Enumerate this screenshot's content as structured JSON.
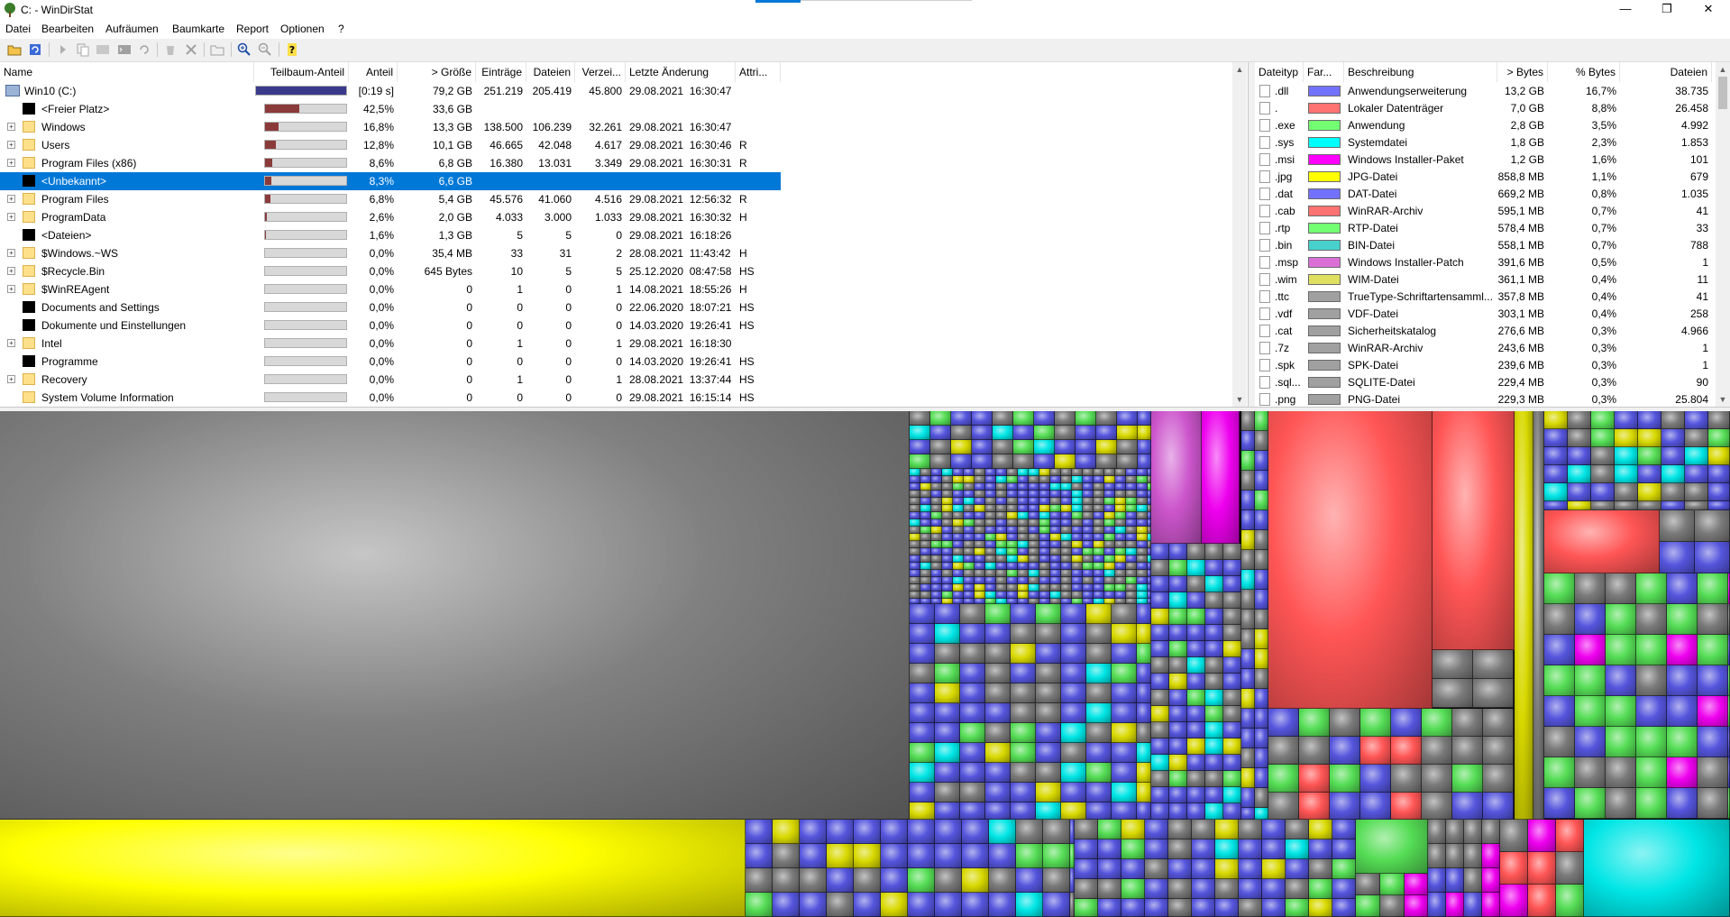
{
  "window": {
    "title": "C: - WinDirStat"
  },
  "menu": [
    "Datei",
    "Bearbeiten",
    "Aufräumen",
    "Baumkarte",
    "Report",
    "Optionen",
    "?"
  ],
  "tree": {
    "columns": [
      "Name",
      "Teilbaum-Anteil",
      "Anteil",
      "> Größe",
      "Einträge",
      "Dateien",
      "Verzei...",
      "Letzte Änderung",
      "Attri..."
    ],
    "rows": [
      {
        "name": "Win10 (C:)",
        "icon": "drive-icon",
        "share_text": "[0:19 s]",
        "fill": 1.0,
        "size": "79,2 GB",
        "entries": "251.219",
        "files": "205.419",
        "dirs": "45.800",
        "modified": "29.08.2021  16:30:47",
        "attr": ""
      },
      {
        "name": "<Freier Platz>",
        "icon": "free-space-icon",
        "share_text": "42,5%",
        "fill": 0.425,
        "size": "33,6 GB",
        "entries": "",
        "files": "",
        "dirs": "",
        "modified": "",
        "attr": ""
      },
      {
        "name": "Windows",
        "icon": "folder-icon",
        "share_text": "16,8%",
        "fill": 0.168,
        "size": "13,3 GB",
        "entries": "138.500",
        "files": "106.239",
        "dirs": "32.261",
        "modified": "29.08.2021  16:30:47",
        "attr": ""
      },
      {
        "name": "Users",
        "icon": "folder-icon",
        "share_text": "12,8%",
        "fill": 0.128,
        "size": "10,1 GB",
        "entries": "46.665",
        "files": "42.048",
        "dirs": "4.617",
        "modified": "29.08.2021  16:30:46",
        "attr": "R"
      },
      {
        "name": "Program Files (x86)",
        "icon": "folder-icon",
        "share_text": "8,6%",
        "fill": 0.086,
        "size": "6,8 GB",
        "entries": "16.380",
        "files": "13.031",
        "dirs": "3.349",
        "modified": "29.08.2021  16:30:31",
        "attr": "R"
      },
      {
        "name": "<Unbekannt>",
        "icon": "unknown-icon",
        "share_text": "8,3%",
        "fill": 0.083,
        "size": "6,6 GB",
        "entries": "",
        "files": "",
        "dirs": "",
        "modified": "",
        "attr": ""
      },
      {
        "name": "Program Files",
        "icon": "folder-icon",
        "share_text": "6,8%",
        "fill": 0.068,
        "size": "5,4 GB",
        "entries": "45.576",
        "files": "41.060",
        "dirs": "4.516",
        "modified": "29.08.2021  12:56:32",
        "attr": "R"
      },
      {
        "name": "ProgramData",
        "icon": "folder-icon",
        "share_text": "2,6%",
        "fill": 0.026,
        "size": "2,0 GB",
        "entries": "4.033",
        "files": "3.000",
        "dirs": "1.033",
        "modified": "29.08.2021  16:30:32",
        "attr": "H"
      },
      {
        "name": "<Dateien>",
        "icon": "files-icon",
        "share_text": "1,6%",
        "fill": 0.016,
        "size": "1,3 GB",
        "entries": "5",
        "files": "5",
        "dirs": "0",
        "modified": "29.08.2021  16:18:26",
        "attr": ""
      },
      {
        "name": "$Windows.~WS",
        "icon": "folder-icon",
        "share_text": "0,0%",
        "fill": 0.0,
        "size": "35,4 MB",
        "entries": "33",
        "files": "31",
        "dirs": "2",
        "modified": "28.08.2021  11:43:42",
        "attr": "H"
      },
      {
        "name": "$Recycle.Bin",
        "icon": "folder-icon",
        "share_text": "0,0%",
        "fill": 0.0,
        "size": "645 Bytes",
        "entries": "10",
        "files": "5",
        "dirs": "5",
        "modified": "25.12.2020  08:47:58",
        "attr": "HS"
      },
      {
        "name": "$WinREAgent",
        "icon": "folder-icon",
        "share_text": "0,0%",
        "fill": 0.0,
        "size": "0",
        "entries": "1",
        "files": "0",
        "dirs": "1",
        "modified": "14.08.2021  18:55:26",
        "attr": "H"
      },
      {
        "name": "Documents and Settings",
        "icon": "junction-icon",
        "share_text": "0,0%",
        "fill": 0.0,
        "size": "0",
        "entries": "0",
        "files": "0",
        "dirs": "0",
        "modified": "22.06.2020  18:07:21",
        "attr": "HS"
      },
      {
        "name": "Dokumente und Einstellungen",
        "icon": "junction-icon",
        "share_text": "0,0%",
        "fill": 0.0,
        "size": "0",
        "entries": "0",
        "files": "0",
        "dirs": "0",
        "modified": "14.03.2020  19:26:41",
        "attr": "HS"
      },
      {
        "name": "Intel",
        "icon": "folder-icon",
        "share_text": "0,0%",
        "fill": 0.0,
        "size": "0",
        "entries": "1",
        "files": "0",
        "dirs": "1",
        "modified": "29.08.2021  16:18:30",
        "attr": ""
      },
      {
        "name": "Programme",
        "icon": "junction-icon",
        "share_text": "0,0%",
        "fill": 0.0,
        "size": "0",
        "entries": "0",
        "files": "0",
        "dirs": "0",
        "modified": "14.03.2020  19:26:41",
        "attr": "HS"
      },
      {
        "name": "Recovery",
        "icon": "folder-icon",
        "share_text": "0,0%",
        "fill": 0.0,
        "size": "0",
        "entries": "1",
        "files": "0",
        "dirs": "1",
        "modified": "28.08.2021  13:37:44",
        "attr": "HS"
      },
      {
        "name": "System Volume Information",
        "icon": "folder-icon",
        "share_text": "0,0%",
        "fill": 0.0,
        "size": "0",
        "entries": "0",
        "files": "0",
        "dirs": "0",
        "modified": "29.08.2021  16:15:14",
        "attr": "HS"
      }
    ],
    "selected_row": 5
  },
  "extensions": {
    "columns": [
      "Dateityp",
      "Far...",
      "Beschreibung",
      "> Bytes",
      "% Bytes",
      "Dateien"
    ],
    "rows": [
      {
        "ext": ".dll",
        "color": "#7272ff",
        "desc": "Anwendungserweiterung",
        "bytes": "13,2 GB",
        "pct": "16,7%",
        "files": "38.735"
      },
      {
        "ext": ".",
        "color": "#ff7272",
        "desc": "Lokaler Datenträger",
        "bytes": "7,0 GB",
        "pct": "8,8%",
        "files": "26.458"
      },
      {
        "ext": ".exe",
        "color": "#72ff72",
        "desc": "Anwendung",
        "bytes": "2,8 GB",
        "pct": "3,5%",
        "files": "4.992"
      },
      {
        "ext": ".sys",
        "color": "#00ffff",
        "desc": "Systemdatei",
        "bytes": "1,8 GB",
        "pct": "2,3%",
        "files": "1.853"
      },
      {
        "ext": ".msi",
        "color": "#ff00ff",
        "desc": "Windows Installer-Paket",
        "bytes": "1,2 GB",
        "pct": "1,6%",
        "files": "101"
      },
      {
        "ext": ".jpg",
        "color": "#ffff00",
        "desc": "JPG-Datei",
        "bytes": "858,8 MB",
        "pct": "1,1%",
        "files": "679"
      },
      {
        "ext": ".dat",
        "color": "#7272ff",
        "desc": "DAT-Datei",
        "bytes": "669,2 MB",
        "pct": "0,8%",
        "files": "1.035"
      },
      {
        "ext": ".cab",
        "color": "#ff7272",
        "desc": "WinRAR-Archiv",
        "bytes": "595,1 MB",
        "pct": "0,7%",
        "files": "41"
      },
      {
        "ext": ".rtp",
        "color": "#72ff72",
        "desc": "RTP-Datei",
        "bytes": "578,4 MB",
        "pct": "0,7%",
        "files": "33"
      },
      {
        "ext": ".bin",
        "color": "#48d1cc",
        "desc": "BIN-Datei",
        "bytes": "558,1 MB",
        "pct": "0,7%",
        "files": "788"
      },
      {
        "ext": ".msp",
        "color": "#da70d6",
        "desc": "Windows Installer-Patch",
        "bytes": "391,6 MB",
        "pct": "0,5%",
        "files": "1"
      },
      {
        "ext": ".wim",
        "color": "#e0e060",
        "desc": "WIM-Datei",
        "bytes": "361,1 MB",
        "pct": "0,4%",
        "files": "11"
      },
      {
        "ext": ".ttc",
        "color": "#a0a0a0",
        "desc": "TrueType-Schriftartensamml...",
        "bytes": "357,8 MB",
        "pct": "0,4%",
        "files": "41"
      },
      {
        "ext": ".vdf",
        "color": "#a0a0a0",
        "desc": "VDF-Datei",
        "bytes": "303,1 MB",
        "pct": "0,4%",
        "files": "258"
      },
      {
        "ext": ".cat",
        "color": "#a0a0a0",
        "desc": "Sicherheitskatalog",
        "bytes": "276,6 MB",
        "pct": "0,3%",
        "files": "4.966"
      },
      {
        "ext": ".7z",
        "color": "#a0a0a0",
        "desc": "WinRAR-Archiv",
        "bytes": "243,6 MB",
        "pct": "0,3%",
        "files": "1"
      },
      {
        "ext": ".spk",
        "color": "#a0a0a0",
        "desc": "SPK-Datei",
        "bytes": "239,6 MB",
        "pct": "0,3%",
        "files": "1"
      },
      {
        "ext": ".sql...",
        "color": "#a0a0a0",
        "desc": "SQLITE-Datei",
        "bytes": "229,4 MB",
        "pct": "0,3%",
        "files": "90"
      },
      {
        "ext": ".png",
        "color": "#a0a0a0",
        "desc": "PNG-Datei",
        "bytes": "229,3 MB",
        "pct": "0,3%",
        "files": "25.804"
      }
    ]
  },
  "treemap": {
    "colors": {
      "free": "#808080",
      "unknown": "#ffff00",
      "dll": "#5555dd",
      "other": "#ff5555",
      "exe": "#55dd55",
      "sys": "#00e5e5",
      "msi": "#ee00ee",
      "gray": "#7a7a7a",
      "jpg": "#d8d800"
    }
  }
}
